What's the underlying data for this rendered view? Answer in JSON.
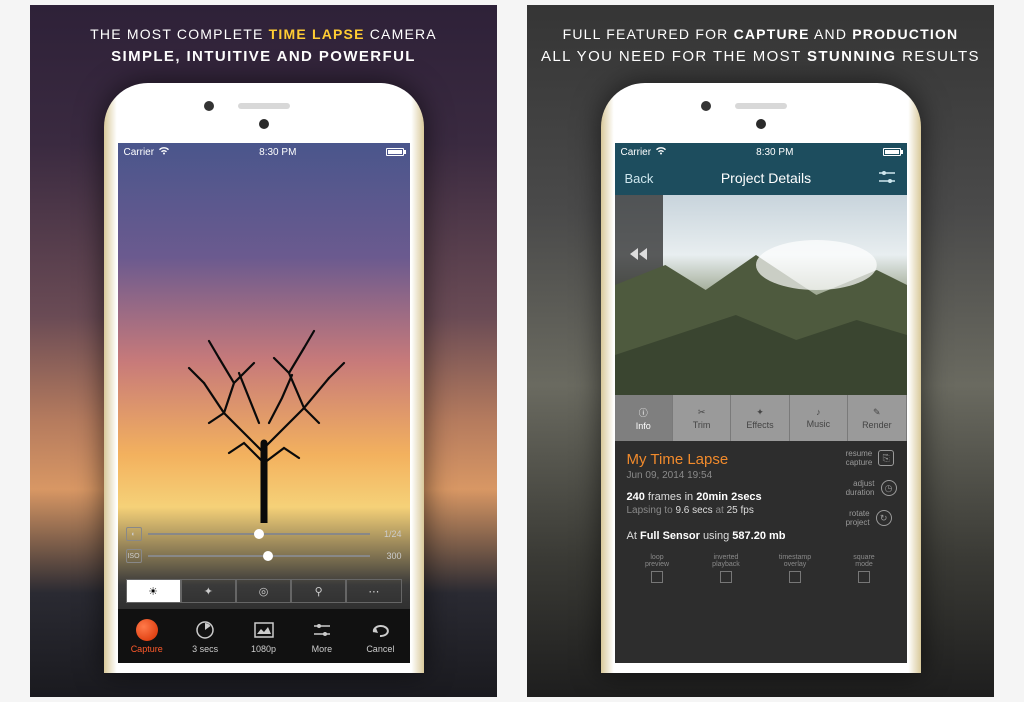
{
  "left": {
    "headline_pre": "The most complete",
    "headline_accent": "time lapse",
    "headline_post": "camera",
    "headline_sub": "simple, intuitive and powerful",
    "status": {
      "carrier": "Carrier",
      "time": "8:30 PM"
    },
    "sliders": [
      {
        "icon": "◐",
        "thumb_pct": 48,
        "value": "1/24"
      },
      {
        "icon": "ISO",
        "thumb_pct": 52,
        "value": "300"
      }
    ],
    "modes": [
      {
        "glyph": "☀",
        "active": true
      },
      {
        "glyph": "✦",
        "active": false
      },
      {
        "glyph": "◎",
        "active": false
      },
      {
        "glyph": "⚲",
        "active": false
      },
      {
        "glyph": "⋯",
        "active": false
      }
    ],
    "toolbar": [
      {
        "name": "capture",
        "label": "Capture",
        "accent": true
      },
      {
        "name": "interval",
        "label": "3 secs"
      },
      {
        "name": "resolution",
        "label": "1080p"
      },
      {
        "name": "more",
        "label": "More"
      },
      {
        "name": "cancel",
        "label": "Cancel"
      }
    ]
  },
  "right": {
    "headline_pre": "Full featured for",
    "headline_b1": "capture",
    "headline_mid": "and",
    "headline_b2": "production",
    "headline_sub_pre": "All you need for the most",
    "headline_sub_b": "stunning",
    "headline_sub_post": "results",
    "status": {
      "carrier": "Carrier",
      "time": "8:30 PM"
    },
    "nav": {
      "back": "Back",
      "title": "Project Details"
    },
    "tabs": [
      {
        "name": "info",
        "label": "Info",
        "active": true
      },
      {
        "name": "trim",
        "label": "Trim"
      },
      {
        "name": "effects",
        "label": "Effects"
      },
      {
        "name": "music",
        "label": "Music"
      },
      {
        "name": "render",
        "label": "Render"
      }
    ],
    "project": {
      "title": "My Time Lapse",
      "date": "Jun 09, 2014 19:54",
      "frames": "240",
      "frames_label": "frames in",
      "duration": "20min 2secs",
      "lapsing_pre": "Lapsing to",
      "lapsing_secs": "9.6 secs",
      "lapsing_at": "at",
      "lapsing_fps": "25 fps",
      "sensor_pre": "At",
      "sensor": "Full Sensor",
      "sensor_using": "using",
      "size": "587.20 mb"
    },
    "side_actions": [
      {
        "name": "resume-capture",
        "label": "resume\ncapture",
        "glyph": "⎘"
      },
      {
        "name": "adjust-duration",
        "label": "adjust\nduration",
        "glyph": "◷"
      },
      {
        "name": "rotate-project",
        "label": "rotate\nproject",
        "glyph": "↻"
      }
    ],
    "checks": [
      {
        "name": "loop-preview",
        "label": "loop\npreview"
      },
      {
        "name": "inverted-playback",
        "label": "inverted\nplayback"
      },
      {
        "name": "timestamp-overlay",
        "label": "timestamp\noverlay"
      },
      {
        "name": "square-mode",
        "label": "square\nmode"
      }
    ]
  }
}
